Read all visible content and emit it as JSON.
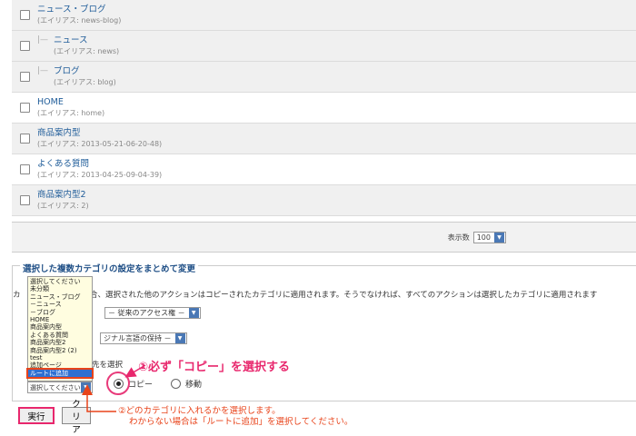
{
  "rows": [
    {
      "name": "ニュース・ブログ",
      "alias": "(エイリアス: news-blog)",
      "level": 0,
      "shade": true
    },
    {
      "name": "ニュース",
      "alias": "(エイリアス: news)",
      "level": 1,
      "shade": true
    },
    {
      "name": "ブログ",
      "alias": "(エイリアス: blog)",
      "level": 1,
      "shade": true
    },
    {
      "name": "HOME",
      "alias": "(エイリアス: home)",
      "level": 0,
      "shade": false
    },
    {
      "name": "商品案内型",
      "alias": "(エイリアス: 2013-05-21-06-20-48)",
      "level": 0,
      "shade": true
    },
    {
      "name": "よくある質問",
      "alias": "(エイリアス: 2013-04-25-09-04-39)",
      "level": 0,
      "shade": false
    },
    {
      "name": "商品案内型2",
      "alias": "(エイリアス: 2)",
      "level": 0,
      "shade": true
    }
  ],
  "tree_mark": "|—",
  "pager": {
    "label": "表示数",
    "value": "100",
    "arrow": "▼"
  },
  "batch": {
    "legend": "選択した複数カテゴリの設定をまとめて変更",
    "description": "カ　　　　　択した場合、選択された他のアクションはコピーされたカテゴリに適用されます。そうでなければ、すべてのアクションは選択したカテゴリに適用されます",
    "access_value": "－ 従来のアクセス権 －",
    "lang_value": "ジナル言語の保持 －",
    "select_label": "先を選択",
    "dropdown_options": [
      "選択してください",
      "未分類",
      "ニュース・ブログ",
      "－ニュース",
      "－ブログ",
      "HOME",
      "商品案内型",
      "よくある質問",
      "商品案内型2",
      "商品案内型2 (2)",
      "test",
      "追加ページ",
      "ルートに追加"
    ],
    "dropdown_highlight": "ルートに追加",
    "bottom_select_value": "選択してください",
    "copy_label": "コピー",
    "move_label": "移動"
  },
  "buttons": {
    "execute": "実行",
    "clear": "クリア"
  },
  "annotations": {
    "note1": "①必ず「コピー」を選択する",
    "note2_line1": "②どのカテゴリに入れるかを選択します。",
    "note2_line2": "わからない場合は「ルートに追加」を選択してください。"
  }
}
